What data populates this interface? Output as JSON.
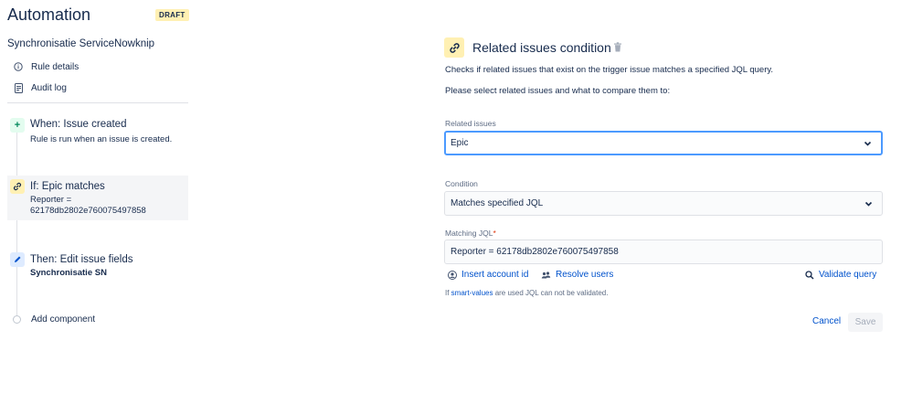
{
  "header": {
    "app_title": "Automation",
    "status_badge": "DRAFT"
  },
  "rule": {
    "name": "Synchronisatie ServiceNowknip"
  },
  "nav": [
    {
      "label": "Rule details",
      "icon": "info-icon"
    },
    {
      "label": "Audit log",
      "icon": "document-icon"
    }
  ],
  "steps": {
    "trigger": {
      "icon": "plus-icon",
      "title": "When: Issue created",
      "desc": "Rule is run when an issue is created."
    },
    "condition": {
      "icon": "link-icon",
      "title": "If: Epic matches",
      "desc_line1": "Reporter =",
      "desc_line2": "62178db2802e760075497858"
    },
    "action": {
      "icon": "pencil-icon",
      "title": "Then: Edit issue fields",
      "desc": "Synchronisatie SN"
    }
  },
  "add_component_label": "Add component",
  "panel": {
    "title": "Related issues condition",
    "description": "Checks if related issues that exist on the trigger issue matches a specified JQL query.",
    "instruction": "Please select related issues and what to compare them to:",
    "related_issues": {
      "label": "Related issues",
      "value": "Epic"
    },
    "condition": {
      "label": "Condition",
      "value": "Matches specified JQL"
    },
    "matching_jql": {
      "label": "Matching JQL",
      "required_mark": "*",
      "value": "Reporter = 62178db2802e760075497858"
    },
    "links": {
      "insert_account": "Insert account id",
      "resolve_users": "Resolve users",
      "validate_query": "Validate query"
    },
    "hint": {
      "link": "smart-values",
      "text": " are used JQL can not be validated.",
      "prefix": "If "
    },
    "actions": {
      "cancel": "Cancel",
      "save": "Save"
    }
  },
  "colors": {
    "accent": "#0052cc",
    "focus_border": "#4c9aff",
    "trigger_bg": "#e3fcef",
    "condition_bg": "#fff0b3",
    "action_bg": "#deebff"
  }
}
